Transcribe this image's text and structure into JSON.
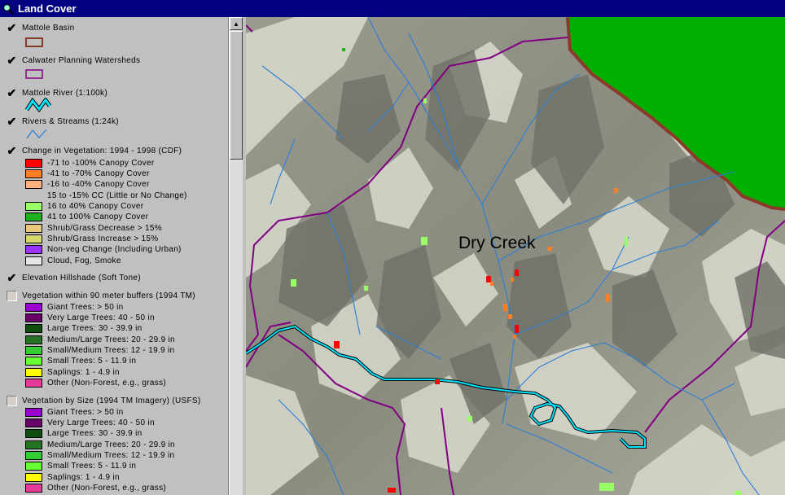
{
  "window": {
    "title": "Land Cover"
  },
  "toc": {
    "layers": [
      {
        "name": "Mattole Basin",
        "checked": true
      },
      {
        "name": "Calwater Planning Watersheds",
        "checked": true
      },
      {
        "name": "Mattole River (1:100k)",
        "checked": true
      },
      {
        "name": "Rivers & Streams (1:24k)",
        "checked": true
      },
      {
        "name": "Change in Vegetation: 1994 - 1998 (CDF)",
        "checked": true,
        "legend": [
          {
            "label": "-71 to -100% Canopy Cover",
            "color": "#ff0000"
          },
          {
            "label": "-41 to -70% Canopy Cover",
            "color": "#ff7f27"
          },
          {
            "label": "-16 to -40% Canopy Cover",
            "color": "#ffb27f"
          },
          {
            "label": "15 to -15% CC (Little or No Change)",
            "color": ""
          },
          {
            "label": "16 to 40% Canopy Cover",
            "color": "#99ff66"
          },
          {
            "label": "41 to 100% Canopy Cover",
            "color": "#1fb01f"
          },
          {
            "label": "Shrub/Grass Decrease > 15%",
            "color": "#e8c87a"
          },
          {
            "label": "Shrub/Grass Increase > 15%",
            "color": "#d6d96e"
          },
          {
            "label": "Non-veg Change (Including Urban)",
            "color": "#9933ff"
          },
          {
            "label": "Cloud, Fog, Smoke",
            "color": "#e6e6e6"
          }
        ]
      },
      {
        "name": "Elevation Hillshade (Soft Tone)",
        "checked": true
      },
      {
        "name": "Vegetation within 90 meter buffers (1994 TM)",
        "checked": false,
        "legend": [
          {
            "label": "Giant Trees: > 50 in",
            "color": "#9900cc"
          },
          {
            "label": "Very Large Trees: 40 - 50 in",
            "color": "#660066"
          },
          {
            "label": "Large Trees: 30 - 39.9 in",
            "color": "#0d4d0d"
          },
          {
            "label": "Medium/Large Trees: 20 - 29.9 in",
            "color": "#267326"
          },
          {
            "label": "Small/Medium Trees: 12 - 19.9 in",
            "color": "#33cc33"
          },
          {
            "label": "Small Trees: 5 - 11.9 in",
            "color": "#66ff33"
          },
          {
            "label": "Saplings: 1 - 4.9 in",
            "color": "#ffff00"
          },
          {
            "label": "Other (Non-Forest, e.g., grass)",
            "color": "#e6399a"
          }
        ]
      },
      {
        "name": "Vegetation by Size (1994 TM Imagery) (USFS)",
        "checked": false,
        "legend": [
          {
            "label": "Giant Trees: > 50 in",
            "color": "#9900cc"
          },
          {
            "label": "Very Large Trees: 40 - 50 in",
            "color": "#660066"
          },
          {
            "label": "Large Trees: 30 - 39.9 in",
            "color": "#0d4d0d"
          },
          {
            "label": "Medium/Large Trees: 20 - 29.9 in",
            "color": "#267326"
          },
          {
            "label": "Small/Medium Trees: 12 - 19.9 in",
            "color": "#33cc33"
          },
          {
            "label": "Small Trees: 5 - 11.9 in",
            "color": "#66ff33"
          },
          {
            "label": "Saplings: 1 - 4.9 in",
            "color": "#ffff00"
          },
          {
            "label": "Other (Non-Forest, e.g., grass)",
            "color": "#e6399a"
          }
        ]
      }
    ]
  },
  "map": {
    "label": "Dry Creek"
  },
  "colors": {
    "titlebar": "#000080",
    "basin_outline": "#8b3a2a",
    "watershed_outline": "#800080",
    "river": "#00e5ff",
    "stream": "#2a7fd4",
    "green_area": "#00b000"
  },
  "icons": {
    "checked": "check-icon",
    "scroll_up": "up-arrow-icon",
    "title": "magnifier-icon"
  }
}
